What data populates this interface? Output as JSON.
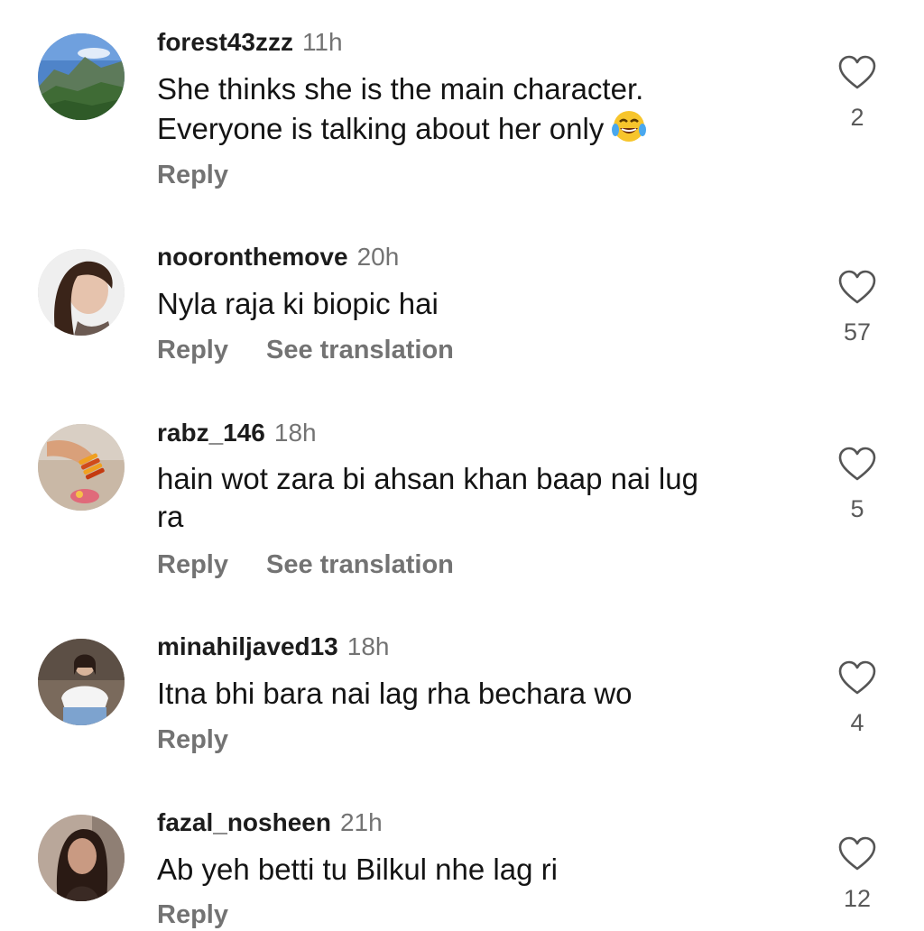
{
  "actions": {
    "reply": "Reply",
    "see_translation": "See translation"
  },
  "comments": [
    {
      "username": "forest43zzz",
      "time": "11h",
      "text_lines": [
        "She thinks she is the main character.",
        "Everyone is talking about her only"
      ],
      "emoji": "face-with-tears-of-joy",
      "likes": "2",
      "has_translation": false
    },
    {
      "username": "nooronthemove",
      "time": "20h",
      "text_lines": [
        "Nyla raja ki biopic hai"
      ],
      "likes": "57",
      "has_translation": true
    },
    {
      "username": "rabz_146",
      "time": "18h",
      "text_lines": [
        "hain wot zara bi ahsan khan baap nai lug",
        "ra"
      ],
      "likes": "5",
      "has_translation": true
    },
    {
      "username": "minahiljaved13",
      "time": "18h",
      "text_lines": [
        "Itna bhi bara nai lag rha bechara wo"
      ],
      "likes": "4",
      "has_translation": false
    },
    {
      "username": "fazal_nosheen",
      "time": "21h",
      "text_lines": [
        "Ab yeh betti tu Bilkul nhe lag ri"
      ],
      "likes": "12",
      "has_translation": false
    }
  ],
  "colors": {
    "text": "#141414",
    "secondary": "#737373",
    "background": "#ffffff"
  }
}
